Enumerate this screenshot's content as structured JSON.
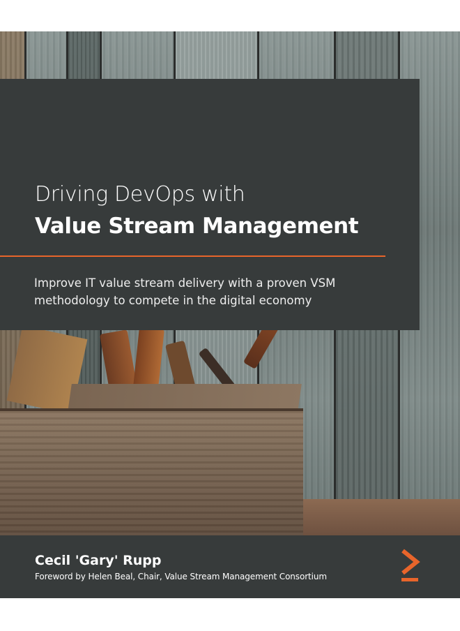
{
  "cover": {
    "title_line1": "Driving DevOps with",
    "title_line2": "Value Stream Management",
    "subtitle": "Improve IT value stream delivery with a proven VSM methodology to compete in the digital economy",
    "author": "Cecil 'Gary' Rupp",
    "foreword": "Foreword by Helen Beal, Chair, Value Stream Management Consortium",
    "accent_color": "#e8652b",
    "panel_color": "#373b3b",
    "logo_icon": "publisher-chevron-logo"
  }
}
